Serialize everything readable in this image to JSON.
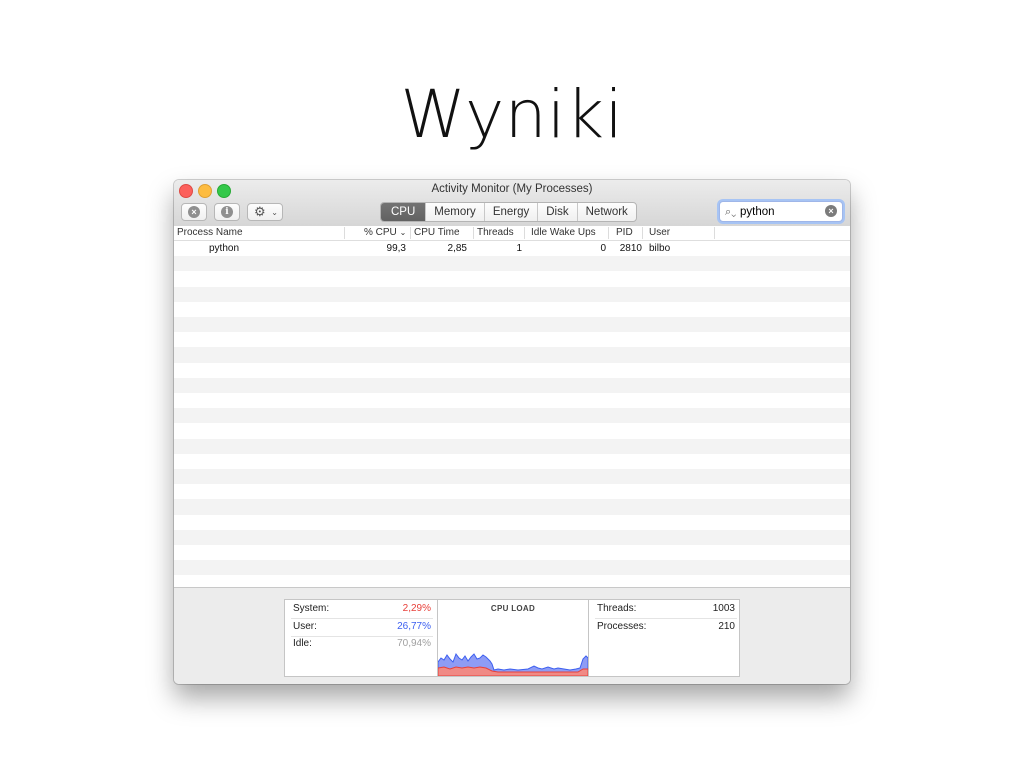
{
  "slide": {
    "title": "Wyniki"
  },
  "window": {
    "title": "Activity Monitor (My Processes)",
    "toolbar": {
      "stop_icon": "x-circle-icon",
      "info_icon": "info-icon",
      "gear_icon": "gear-icon",
      "stop_glyph": "×",
      "info_glyph": "i",
      "gear_glyph": "⚙",
      "caret_glyph": "⌄"
    },
    "tabs": [
      {
        "label": "CPU",
        "active": true
      },
      {
        "label": "Memory"
      },
      {
        "label": "Energy"
      },
      {
        "label": "Disk"
      },
      {
        "label": "Network"
      }
    ],
    "search": {
      "value": "python",
      "icon": "search-icon",
      "clear_glyph": "×"
    }
  },
  "table": {
    "columns": [
      "Process Name",
      "% CPU",
      "CPU Time",
      "Threads",
      "Idle Wake Ups",
      "PID",
      "User"
    ],
    "rows": [
      [
        "python",
        "99,3",
        "2,85",
        "1",
        "0",
        "2810",
        "bilbo"
      ]
    ]
  },
  "footer": {
    "system_label": "System:",
    "system_value": "2,29%",
    "user_label": "User:",
    "user_value": "26,77%",
    "idle_label": "Idle:",
    "idle_value": "70,94%",
    "cpu_load_title": "CPU LOAD",
    "threads_label": "Threads:",
    "threads_value": "1003",
    "processes_label": "Processes:",
    "processes_value": "210",
    "colors": {
      "system": "#e8403a",
      "user": "#3c5ff0",
      "idle": "#a0a0a0"
    }
  }
}
